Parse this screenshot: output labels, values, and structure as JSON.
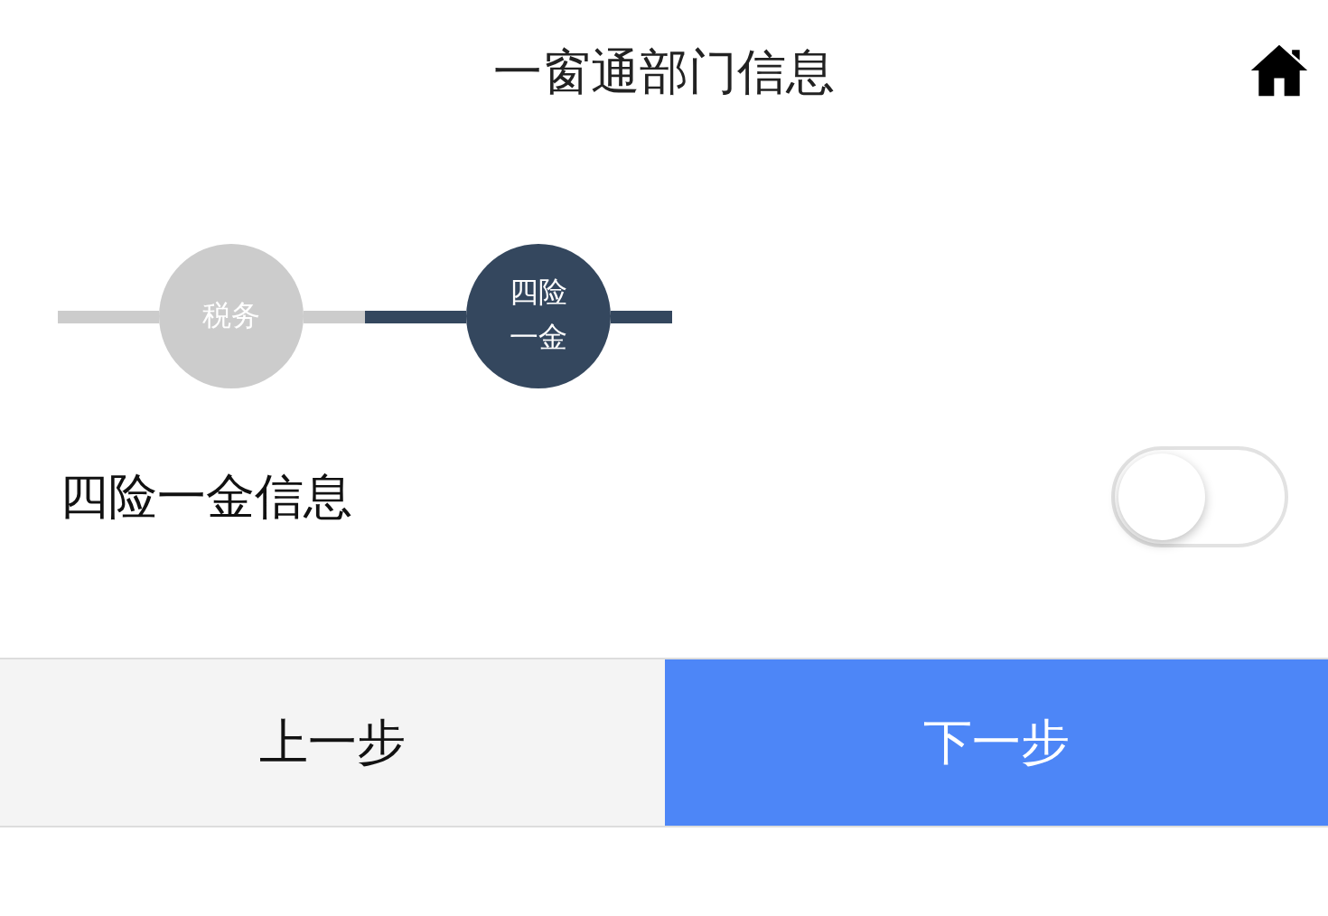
{
  "header": {
    "title": "一窗通部门信息"
  },
  "steps": [
    {
      "label": "税务",
      "selected": false
    },
    {
      "label": "四险一金",
      "selected": true
    }
  ],
  "setting": {
    "label": "四险一金信息",
    "on": false
  },
  "buttons": [
    {
      "label": "上一步",
      "kind": "secondary"
    },
    {
      "label": "下一步",
      "kind": "primary"
    }
  ]
}
